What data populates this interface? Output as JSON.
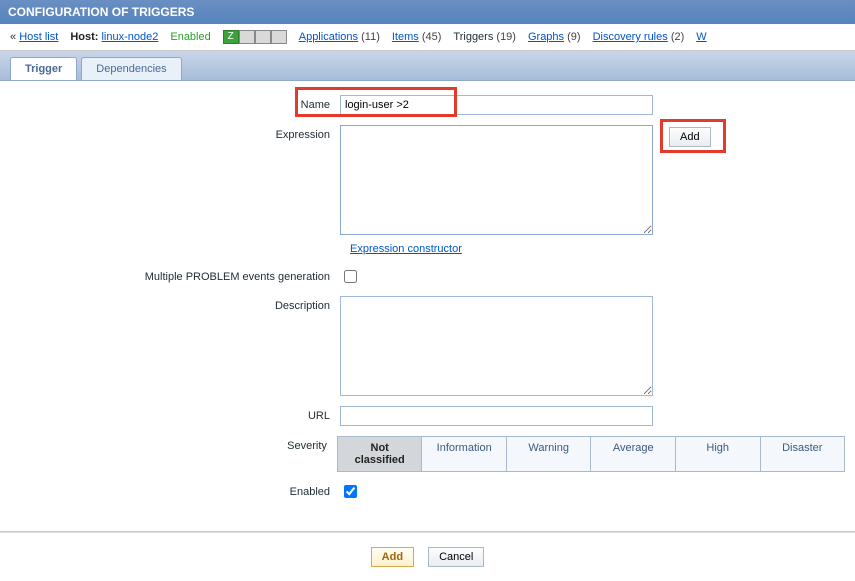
{
  "header": {
    "title": "CONFIGURATION OF TRIGGERS"
  },
  "subbar": {
    "hostlist_label": "Host list",
    "host_label": "Host:",
    "host_name": "linux-node2",
    "status": "Enabled",
    "icon_letter": "Z",
    "links": {
      "applications": {
        "label": "Applications",
        "count": "(11)"
      },
      "items": {
        "label": "Items",
        "count": "(45)"
      },
      "triggers": {
        "label": "Triggers",
        "count": "(19)"
      },
      "graphs": {
        "label": "Graphs",
        "count": "(9)"
      },
      "discovery": {
        "label": "Discovery rules",
        "count": "(2)"
      },
      "web": {
        "label": "W"
      }
    }
  },
  "tabs": {
    "trigger": "Trigger",
    "dependencies": "Dependencies"
  },
  "form": {
    "name_label": "Name",
    "name_value": "login-user >2",
    "expression_label": "Expression",
    "expression_value": "",
    "add_btn": "Add",
    "expr_constructor": "Expression constructor",
    "multi_problem_label": "Multiple PROBLEM events generation",
    "description_label": "Description",
    "description_value": "",
    "url_label": "URL",
    "url_value": "",
    "severity_label": "Severity",
    "severities": [
      "Not classified",
      "Information",
      "Warning",
      "Average",
      "High",
      "Disaster"
    ],
    "enabled_label": "Enabled"
  },
  "footer": {
    "add": "Add",
    "cancel": "Cancel"
  }
}
